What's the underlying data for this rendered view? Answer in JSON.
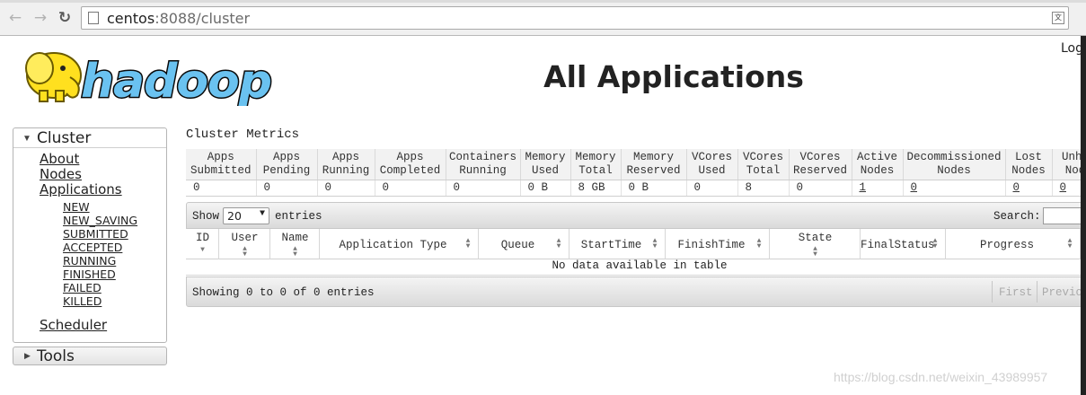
{
  "browser": {
    "url_host": "centos",
    "url_rest": ":8088/cluster"
  },
  "header": {
    "logo_text": "hadoop",
    "title": "All Applications",
    "login_text": "Log"
  },
  "sidebar": {
    "cluster_label": "Cluster",
    "links": [
      "About",
      "Nodes",
      "Applications"
    ],
    "states": [
      "NEW",
      "NEW_SAVING",
      "SUBMITTED",
      "ACCEPTED",
      "RUNNING",
      "FINISHED",
      "FAILED",
      "KILLED"
    ],
    "scheduler_label": "Scheduler",
    "tools_label": "Tools"
  },
  "metrics": {
    "title": "Cluster Metrics",
    "headers": [
      [
        "Apps",
        "Submitted"
      ],
      [
        "Apps",
        "Pending"
      ],
      [
        "Apps",
        "Running"
      ],
      [
        "Apps",
        "Completed"
      ],
      [
        "Containers",
        "Running"
      ],
      [
        "Memory",
        "Used"
      ],
      [
        "Memory",
        "Total"
      ],
      [
        "Memory",
        "Reserved"
      ],
      [
        "VCores",
        "Used"
      ],
      [
        "VCores",
        "Total"
      ],
      [
        "VCores",
        "Reserved"
      ],
      [
        "Active",
        "Nodes"
      ],
      [
        "Decommissioned",
        "Nodes"
      ],
      [
        "Lost",
        "Nodes"
      ],
      [
        "Unhe",
        "Nod"
      ]
    ],
    "values": [
      "0",
      "0",
      "0",
      "0",
      "0",
      "0 B",
      "8 GB",
      "0 B",
      "0",
      "8",
      "0",
      "1",
      "0",
      "0",
      "0"
    ]
  },
  "apps": {
    "show_label": "Show",
    "length_value": "20",
    "entries_label": "entries",
    "search_label": "Search:",
    "columns": [
      [
        "ID"
      ],
      [
        "User"
      ],
      [
        "Name"
      ],
      [
        "Application Type"
      ],
      [
        "Queue"
      ],
      [
        "StartTime"
      ],
      [
        "FinishTime"
      ],
      [
        "State"
      ],
      [
        "FinalStatus"
      ],
      [
        "Progress"
      ]
    ],
    "empty_text": "No data available in table",
    "info_text": "Showing 0 to 0 of 0 entries",
    "first_label": "First",
    "previous_label": "Previo"
  },
  "watermark": "https://blog.csdn.net/weixin_43989957"
}
